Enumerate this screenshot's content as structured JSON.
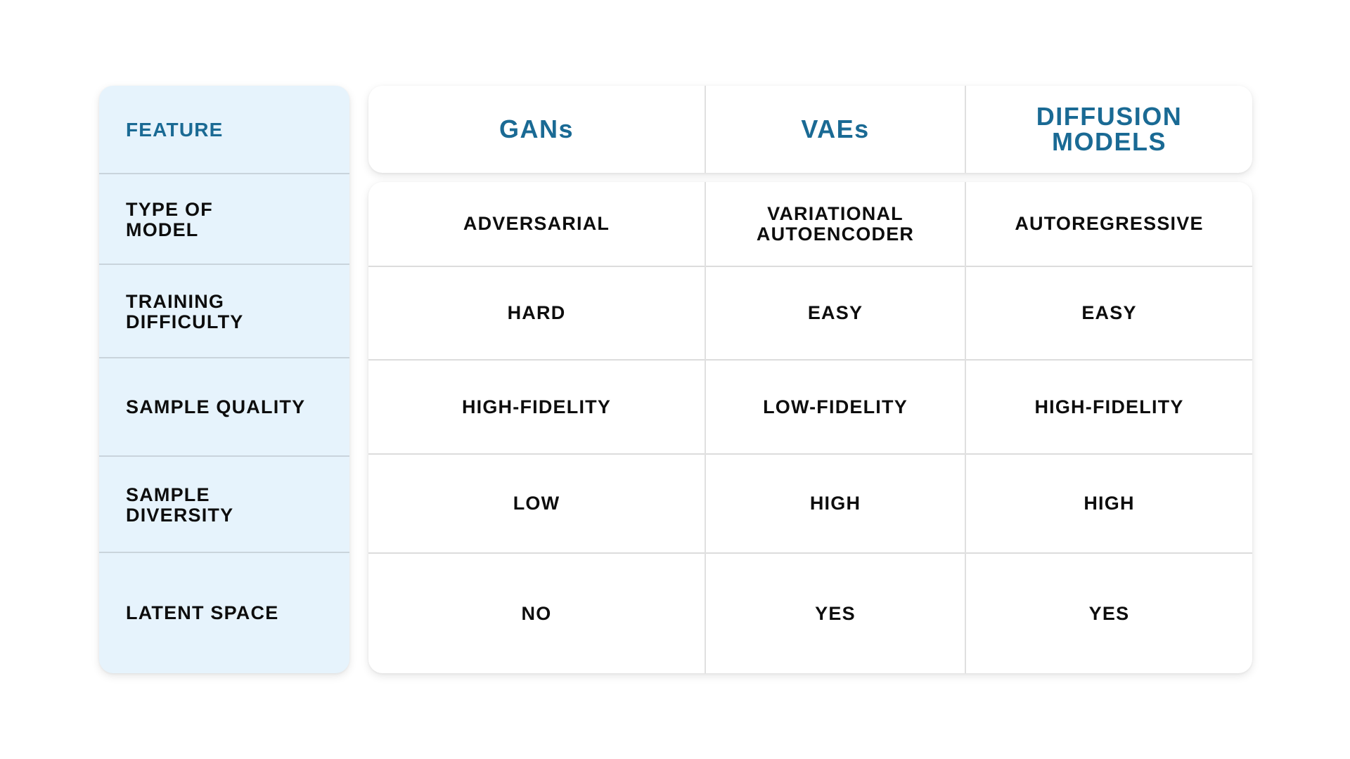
{
  "table": {
    "corner_label": "FEATURE",
    "accent_color": "#1a6a94",
    "feature_panel_bg": "#e6f3fc",
    "columns": [
      {
        "label": "GANs"
      },
      {
        "label": "VAEs"
      },
      {
        "label": "DIFFUSION MODELS"
      }
    ],
    "rows": [
      {
        "feature": "TYPE OF MODEL",
        "values": [
          "ADVERSARIAL",
          "VARIATIONAL AUTOENCODER",
          "AUTOREGRESSIVE"
        ]
      },
      {
        "feature": "TRAINING DIFFICULTY",
        "values": [
          "HARD",
          "EASY",
          "EASY"
        ]
      },
      {
        "feature": "SAMPLE QUALITY",
        "values": [
          "HIGH-FIDELITY",
          "LOW-FIDELITY",
          "HIGH-FIDELITY"
        ]
      },
      {
        "feature": "SAMPLE DIVERSITY",
        "values": [
          "LOW",
          "HIGH",
          "HIGH"
        ]
      },
      {
        "feature": "LATENT SPACE",
        "values": [
          "NO",
          "YES",
          "YES"
        ]
      }
    ]
  }
}
